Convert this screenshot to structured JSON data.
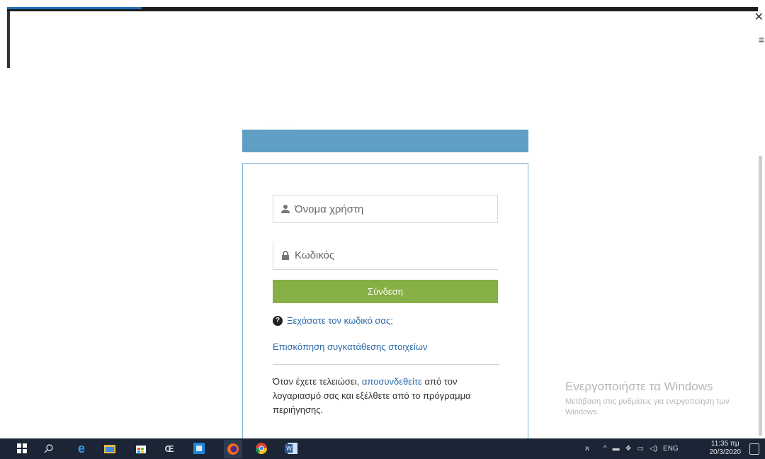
{
  "login": {
    "username_placeholder": "Όνομα χρήστη",
    "password_placeholder": "Κωδικός",
    "login_button": "Σύνδεση",
    "forgot_password": "Ξεχάσατε τον κωδικό σας;",
    "consent_link": "Επισκόπηση συγκατάθεσης στοιχείων",
    "logout_prefix": "Όταν έχετε τελειώσει, ",
    "logout_link": "αποσυνδεθείτε",
    "logout_suffix": " από τον λογαριασμό σας και εξέλθετε από το πρόγραμμα περιήγησης."
  },
  "watermark": {
    "title": "Ενεργοποιήστε τα Windows",
    "subtitle": "Μετάβαση στις ρυθμίσεις για ενεργοποίηση των Windows."
  },
  "taskbar": {
    "apps": [
      "windows-start-icon",
      "search-icon",
      "edge-icon",
      "file-explorer-icon",
      "store-icon",
      "app-ce-icon",
      "calculator-icon",
      "firefox-icon",
      "chrome-icon",
      "word-icon"
    ],
    "language": "ENG",
    "time": "11:35 πμ",
    "date": "20/3/2020"
  }
}
